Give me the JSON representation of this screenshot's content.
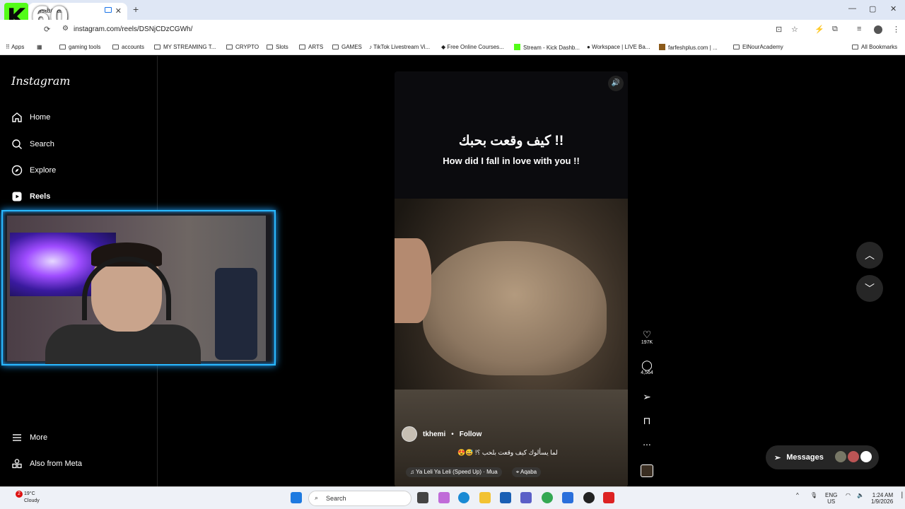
{
  "browser": {
    "tab_title": "Instagram",
    "url": "instagram.com/reels/DSNjCDzCGWh/",
    "new_tab": "+",
    "tab_close": "✕",
    "win_min": "—",
    "win_max": "▢",
    "win_close": "✕",
    "bookmarks": [
      {
        "label": "Apps"
      },
      {
        "label": "gaming tools"
      },
      {
        "label": "accounts"
      },
      {
        "label": "MY STREAMING T..."
      },
      {
        "label": "CRYPTO"
      },
      {
        "label": "Slots"
      },
      {
        "label": "ARTS"
      },
      {
        "label": "GAMES"
      },
      {
        "label": "TikTok Livestream Vi..."
      },
      {
        "label": "Free Online Courses..."
      },
      {
        "label": "Stream - Kick Dashb..."
      },
      {
        "label": "Workspace | LIVE Ba..."
      },
      {
        "label": "farfeshplus.com | ..."
      },
      {
        "label": "ElNourAcademy"
      },
      {
        "label": "All Bookmarks"
      }
    ]
  },
  "overlay": {
    "logo_letter": "K",
    "viewer_count": "60"
  },
  "sidebar": {
    "logo": "Instagram",
    "items": [
      {
        "label": "Home",
        "icon": "home-icon"
      },
      {
        "label": "Search",
        "icon": "search-icon"
      },
      {
        "label": "Explore",
        "icon": "compass-icon"
      },
      {
        "label": "Reels",
        "icon": "reels-icon"
      },
      {
        "label": "More",
        "icon": "menu-icon"
      },
      {
        "label": "Also from Meta",
        "icon": "meta-icon"
      }
    ]
  },
  "reel": {
    "title_ar": "كيف وقعت بحبك !!",
    "title_en": "How did I fall in love with you !!",
    "username": "tkhemi",
    "dot": "•",
    "follow": "Follow",
    "caption": "لما يسألوك كيف وقعت بلحب ؟! 😅😍",
    "music": "Ya Leli Ya Leli (Speed Up) · Mua",
    "location": "Aqaba",
    "likes": "197K",
    "comments": "4,564",
    "more": "..."
  },
  "messages": {
    "label": "Messages"
  },
  "taskbar": {
    "weather_temp": "19°C",
    "weather_desc": "Cloudy",
    "weather_badge": "2",
    "search": "Search",
    "lang1": "ENG",
    "lang2": "US",
    "time": "1:24 AM",
    "date": "1/9/2026"
  }
}
